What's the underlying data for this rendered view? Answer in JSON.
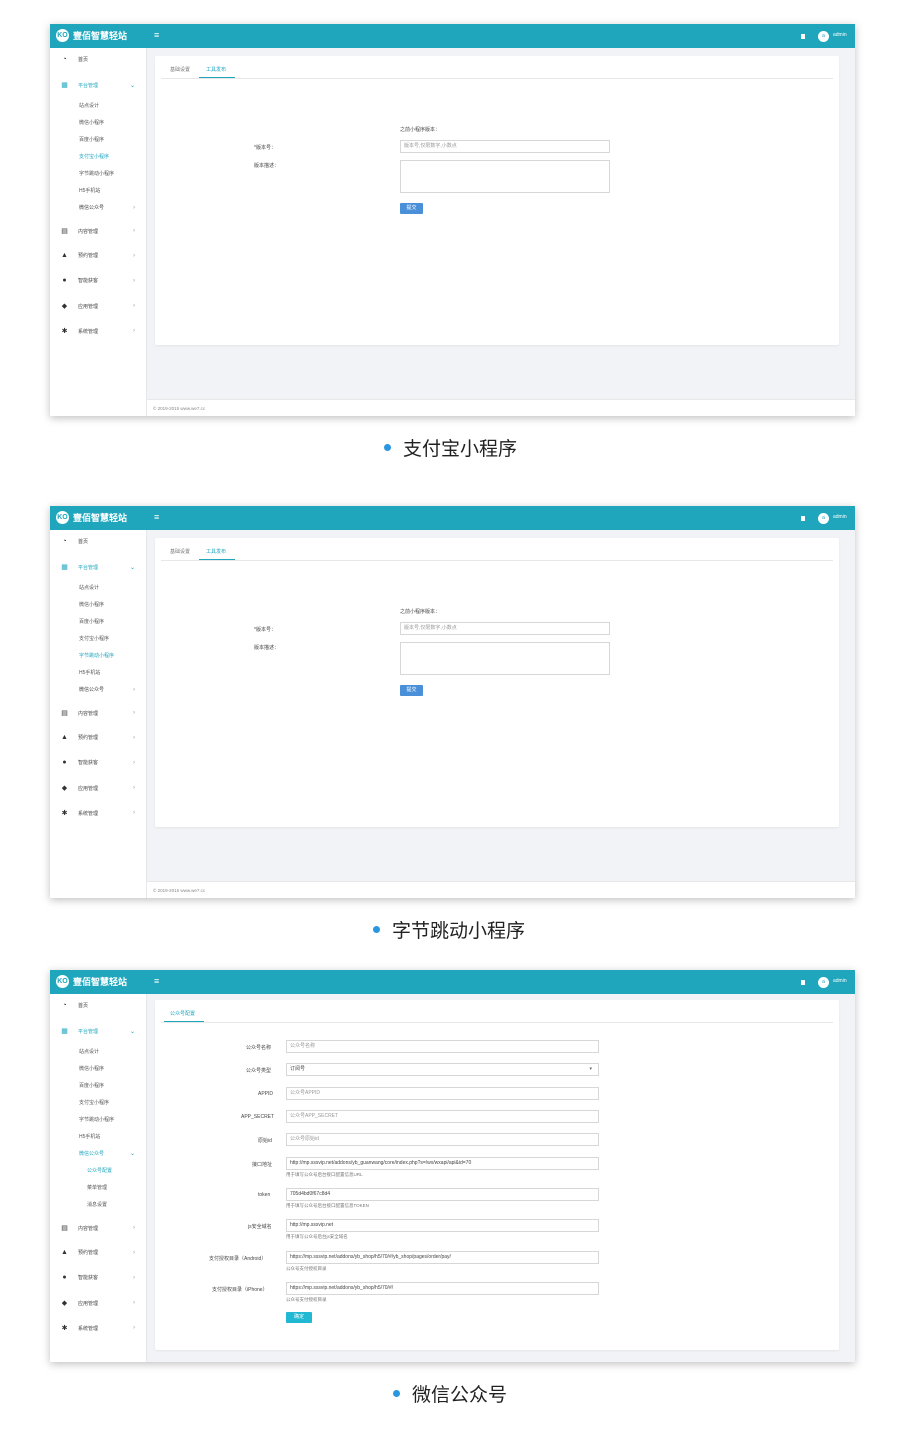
{
  "brand_name": "壹佰智慧轻站",
  "logo_glyph": "KO",
  "menu_glyph": "≡",
  "user": {
    "avatar_initial": "a",
    "name": "admin"
  },
  "nav": {
    "home": "首页",
    "platform": "平台管理",
    "platform_items": [
      "站点设计",
      "微信小程序",
      "百度小程序",
      "支付宝小程序",
      "字节跳动小程序",
      "H5手机站",
      "微信公众号"
    ],
    "wechat_sub": [
      "公众号配置",
      "菜单管理",
      "消息设置"
    ],
    "content": "内容管理",
    "booking": "预约管理",
    "smart": "智能获客",
    "apps": "应用管理",
    "system": "系统管理"
  },
  "release_form": {
    "tab_basic": "基础设置",
    "tab_release": "工具发布",
    "prev_version_label": "之前小程序版本：",
    "version_label": "*版本号：",
    "version_placeholder": "版本号,仅限数字,小数点",
    "desc_label": "版本描述：",
    "submit": "提交"
  },
  "mp_form": {
    "tab": "公众号配置",
    "name_label": "公众号名称",
    "name_placeholder": "公众号名称",
    "type_label": "公众号类型",
    "type_value": "订阅号",
    "appid_label": "APPID",
    "appid_placeholder": "公众号APPID",
    "secret_label": "APP_SECRET",
    "secret_placeholder": "公众号APP_SECRET",
    "origin_label": "原始id",
    "origin_placeholder": "公众号原始id",
    "url_label": "接口地址",
    "url_value": "http://mp.sssvip.net/addons/yb_guanwang/core/index.php?s=/wx/wxapi/api&id=70",
    "url_help": "用于填写公众号后台接口配置信息URL",
    "token_label": "token",
    "token_value": "705d4bd0f67c8d4",
    "token_help": "用于填写公众号后台接口配置信息TOKEN",
    "js_label": "js安全域名",
    "js_value": "http://mp.sssvip.net",
    "js_help": "用于填写公众号后台js安全域名",
    "pay_android_label": "支付授权目录（Android）",
    "pay_android_value": "https://mp.sssvip.net/addons/yb_shop/h5/70/#/yb_shop/pages/order/pay/",
    "pay_android_help": "公众号支付授权目录",
    "pay_iphone_label": "支付授权目录（iPhone）",
    "pay_iphone_value": "https://mp.sssvip.net/addons/yb_shop/h5/70/#/",
    "pay_iphone_help": "公众号支付授权目录",
    "confirm": "确定"
  },
  "footer": "© 2019-2015 www.we7.cc",
  "captions": [
    "支付宝小程序",
    "字节跳动小程序",
    "微信公众号"
  ],
  "colors": {
    "header": "#1fa6bd",
    "accent": "#1fa6bd",
    "submit": "#4a90d9",
    "bullet": "#2996e0"
  }
}
